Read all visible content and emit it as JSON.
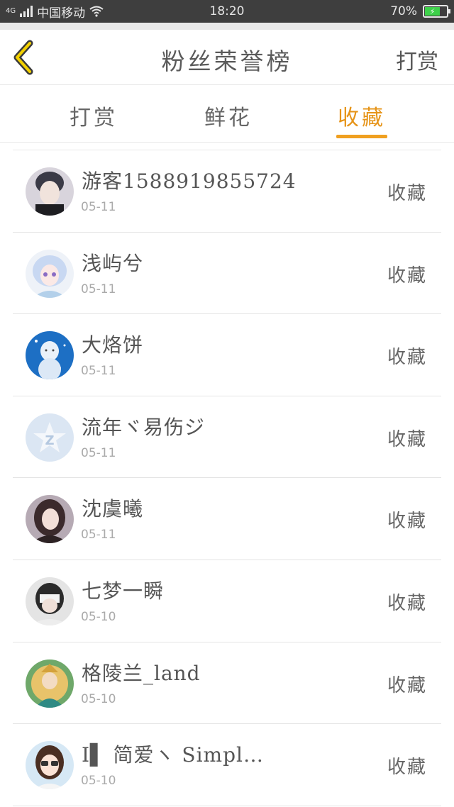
{
  "status_bar": {
    "network_tag": "4G",
    "carrier": "中国移动",
    "time": "18:20",
    "battery": "70%",
    "battery_level": 0.7
  },
  "header": {
    "title": "粉丝荣誉榜",
    "action_label": "打赏"
  },
  "tabs": [
    {
      "label": "打赏",
      "active": false
    },
    {
      "label": "鲜花",
      "active": false
    },
    {
      "label": "收藏",
      "active": true
    }
  ],
  "fans": [
    {
      "name": "游客15889198​55724",
      "date": "05-11",
      "type": "收藏",
      "avatar": "male-portrait"
    },
    {
      "name": "浅屿兮",
      "date": "05-11",
      "type": "收藏",
      "avatar": "anime-girl"
    },
    {
      "name": "大烙饼",
      "date": "05-11",
      "type": "收藏",
      "avatar": "blue-character"
    },
    {
      "name": "流年ヾ易伤ジ",
      "date": "05-11",
      "type": "收藏",
      "avatar": "default-qq"
    },
    {
      "name": "沈虞曦",
      "date": "05-11",
      "type": "收藏",
      "avatar": "female-portrait"
    },
    {
      "name": "七梦一瞬",
      "date": "05-10",
      "type": "收藏",
      "avatar": "masked-girl"
    },
    {
      "name": "格陵兰_land",
      "date": "05-10",
      "type": "收藏",
      "avatar": "game-character"
    },
    {
      "name": "I▌ 简爱ヽ Simpl…",
      "date": "05-10",
      "type": "收藏",
      "avatar": "cartoon-girl"
    }
  ],
  "colors": {
    "accent": "#f0a020",
    "status_bar": "#3e3e3e",
    "battery": "#3ed14a"
  }
}
